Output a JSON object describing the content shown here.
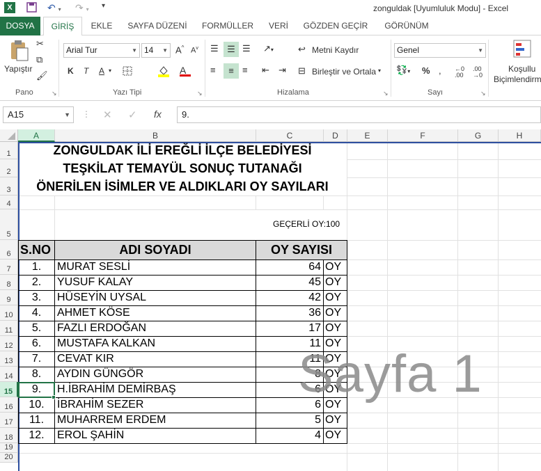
{
  "window": {
    "title": "zonguldak  [Uyumluluk Modu] - Excel"
  },
  "tabs": [
    "DOSYA",
    "GİRİŞ",
    "EKLE",
    "SAYFA DÜZENİ",
    "FORMÜLLER",
    "VERİ",
    "GÖZDEN GEÇİR",
    "GÖRÜNÜM"
  ],
  "ribbon": {
    "pano": {
      "label": "Pano",
      "paste": "Yapıştır"
    },
    "font": {
      "label": "Yazı Tipi",
      "name": "Arial Tur",
      "size": "14",
      "bold": "K",
      "italic": "T",
      "underline": "A"
    },
    "align": {
      "label": "Hizalama",
      "wrap": "Metni Kaydır",
      "merge": "Birleştir ve Ortala"
    },
    "number": {
      "label": "Sayı",
      "format": "Genel",
      "pct": "%"
    },
    "styles": {
      "cond1": "Koşullu",
      "cond2": "Biçimlendirm"
    }
  },
  "formula": {
    "namebox": "A15",
    "content": "9."
  },
  "columns": [
    "A",
    "B",
    "C",
    "D",
    "E",
    "F",
    "G",
    "H"
  ],
  "rows": [
    "1",
    "2",
    "3",
    "4",
    "5",
    "6",
    "7",
    "8",
    "9",
    "10",
    "11",
    "12",
    "13",
    "14",
    "15",
    "16",
    "17",
    "18",
    "19",
    "20"
  ],
  "sheet": {
    "title1": "ZONGULDAK İLİ EREĞLİ İLÇE BELEDİYESİ",
    "title2": "TEŞKİLAT TEMAYÜL SONUÇ TUTANAĞI",
    "title3": "ÖNERİLEN İSİMLER VE ALDIKLARI OY SAYILARI",
    "valid_votes": "GEÇERLİ OY:100",
    "headers": {
      "no": "S.NO",
      "name": "ADI SOYADI",
      "votes": "OY SAYISI"
    },
    "entries": [
      {
        "no": "1.",
        "name": "MURAT SESLİ",
        "votes": "64",
        "unit": "OY"
      },
      {
        "no": "2.",
        "name": "YUSUF KALAY",
        "votes": "45",
        "unit": "OY"
      },
      {
        "no": "3.",
        "name": "HÜSEYİN UYSAL",
        "votes": "42",
        "unit": "OY"
      },
      {
        "no": "4.",
        "name": "AHMET KÖSE",
        "votes": "36",
        "unit": "OY"
      },
      {
        "no": "5.",
        "name": "FAZLI ERDOĞAN",
        "votes": "17",
        "unit": "OY"
      },
      {
        "no": "6.",
        "name": "MUSTAFA KALKAN",
        "votes": "11",
        "unit": "OY"
      },
      {
        "no": "7.",
        "name": "CEVAT KIR",
        "votes": "11",
        "unit": "OY"
      },
      {
        "no": "8.",
        "name": "AYDIN GÜNGÖR",
        "votes": "8",
        "unit": "OY"
      },
      {
        "no": "9.",
        "name": "H.İBRAHİM DEMİRBAŞ",
        "votes": "6",
        "unit": "OY"
      },
      {
        "no": "10.",
        "name": "İBRAHİM SEZER",
        "votes": "6",
        "unit": "OY"
      },
      {
        "no": "11.",
        "name": "MUHARREM ERDEM",
        "votes": "5",
        "unit": "OY"
      },
      {
        "no": "12.",
        "name": "EROL ŞAHİN",
        "votes": "4",
        "unit": "OY"
      }
    ],
    "watermark": "Sayfa 1"
  }
}
